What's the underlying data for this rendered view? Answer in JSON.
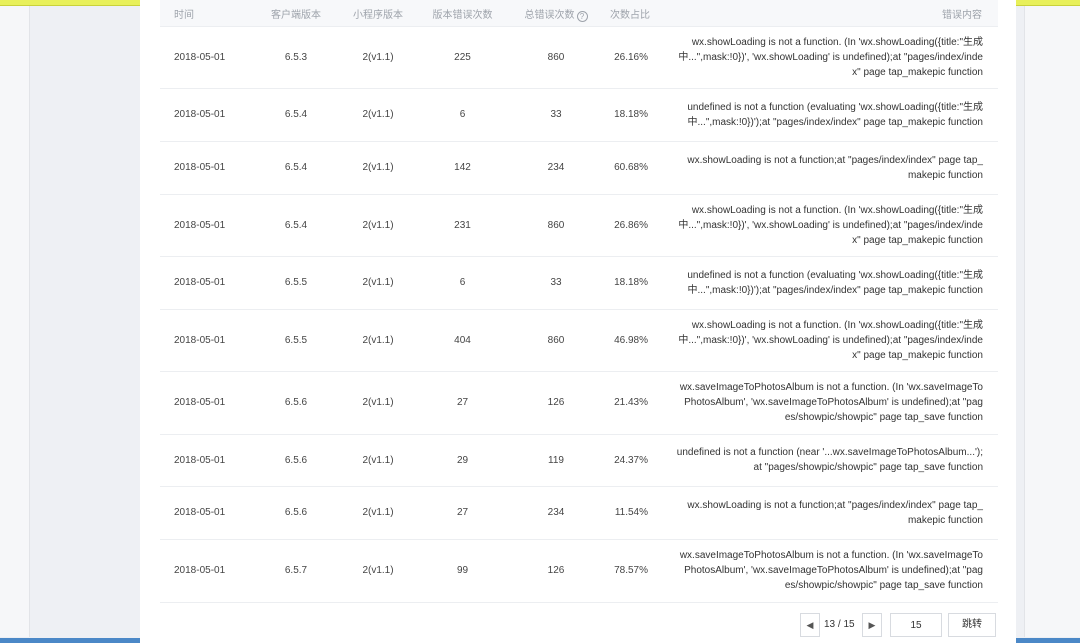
{
  "table": {
    "headers": {
      "time": "时间",
      "client_version": "客户端版本",
      "miniprogram_version": "小程序版本",
      "version_error_count": "版本错误次数",
      "total_error_count": "总错误次数",
      "ratio": "次数占比",
      "error_content": "错误内容"
    },
    "help_icon": "question-circle-icon",
    "rows": [
      {
        "time": "2018-05-01",
        "client": "6.5.3",
        "mini": "2(v1.1)",
        "ver_count": "225",
        "total": "860",
        "ratio": "26.16%",
        "msg": [
          "wx.showLoading is not a function. (In 'wx.showLoading({title:\"生成",
          "中...\",mask:!0})', 'wx.showLoading' is undefined);at \"pages/index/inde",
          "x\" page tap_makepic function"
        ]
      },
      {
        "time": "2018-05-01",
        "client": "6.5.4",
        "mini": "2(v1.1)",
        "ver_count": "6",
        "total": "33",
        "ratio": "18.18%",
        "msg": [
          "undefined is not a function (evaluating 'wx.showLoading({title:\"生成",
          "中...\",mask:!0})');at \"pages/index/index\" page tap_makepic function"
        ]
      },
      {
        "time": "2018-05-01",
        "client": "6.5.4",
        "mini": "2(v1.1)",
        "ver_count": "142",
        "total": "234",
        "ratio": "60.68%",
        "msg": [
          "wx.showLoading is not a function;at \"pages/index/index\" page tap_",
          "makepic function"
        ]
      },
      {
        "time": "2018-05-01",
        "client": "6.5.4",
        "mini": "2(v1.1)",
        "ver_count": "231",
        "total": "860",
        "ratio": "26.86%",
        "msg": [
          "wx.showLoading is not a function. (In 'wx.showLoading({title:\"生成",
          "中...\",mask:!0})', 'wx.showLoading' is undefined);at \"pages/index/inde",
          "x\" page tap_makepic function"
        ]
      },
      {
        "time": "2018-05-01",
        "client": "6.5.5",
        "mini": "2(v1.1)",
        "ver_count": "6",
        "total": "33",
        "ratio": "18.18%",
        "msg": [
          "undefined is not a function (evaluating 'wx.showLoading({title:\"生成",
          "中...\",mask:!0})');at \"pages/index/index\" page tap_makepic function"
        ]
      },
      {
        "time": "2018-05-01",
        "client": "6.5.5",
        "mini": "2(v1.1)",
        "ver_count": "404",
        "total": "860",
        "ratio": "46.98%",
        "msg": [
          "wx.showLoading is not a function. (In 'wx.showLoading({title:\"生成",
          "中...\",mask:!0})', 'wx.showLoading' is undefined);at \"pages/index/inde",
          "x\" page tap_makepic function"
        ]
      },
      {
        "time": "2018-05-01",
        "client": "6.5.6",
        "mini": "2(v1.1)",
        "ver_count": "27",
        "total": "126",
        "ratio": "21.43%",
        "msg": [
          "wx.saveImageToPhotosAlbum is not a function. (In 'wx.saveImageTo",
          "PhotosAlbum', 'wx.saveImageToPhotosAlbum' is undefined);at \"pag",
          "es/showpic/showpic\" page tap_save function"
        ]
      },
      {
        "time": "2018-05-01",
        "client": "6.5.6",
        "mini": "2(v1.1)",
        "ver_count": "29",
        "total": "119",
        "ratio": "24.37%",
        "msg": [
          "undefined is not a function (near '...wx.saveImageToPhotosAlbum...');",
          "at \"pages/showpic/showpic\" page tap_save function"
        ]
      },
      {
        "time": "2018-05-01",
        "client": "6.5.6",
        "mini": "2(v1.1)",
        "ver_count": "27",
        "total": "234",
        "ratio": "11.54%",
        "msg": [
          "wx.showLoading is not a function;at \"pages/index/index\" page tap_",
          "makepic function"
        ]
      },
      {
        "time": "2018-05-01",
        "client": "6.5.7",
        "mini": "2(v1.1)",
        "ver_count": "99",
        "total": "126",
        "ratio": "78.57%",
        "msg": [
          "wx.saveImageToPhotosAlbum is not a function. (In 'wx.saveImageTo",
          "PhotosAlbum', 'wx.saveImageToPhotosAlbum' is undefined);at \"pag",
          "es/showpic/showpic\" page tap_save function"
        ]
      }
    ]
  },
  "pagination": {
    "prev_icon": "chevron-left-icon",
    "next_icon": "chevron-right-icon",
    "prev_glyph": "◀",
    "next_glyph": "▶",
    "page_indicator": "13 / 15",
    "page_input_value": "15",
    "jump_label": "跳转"
  }
}
